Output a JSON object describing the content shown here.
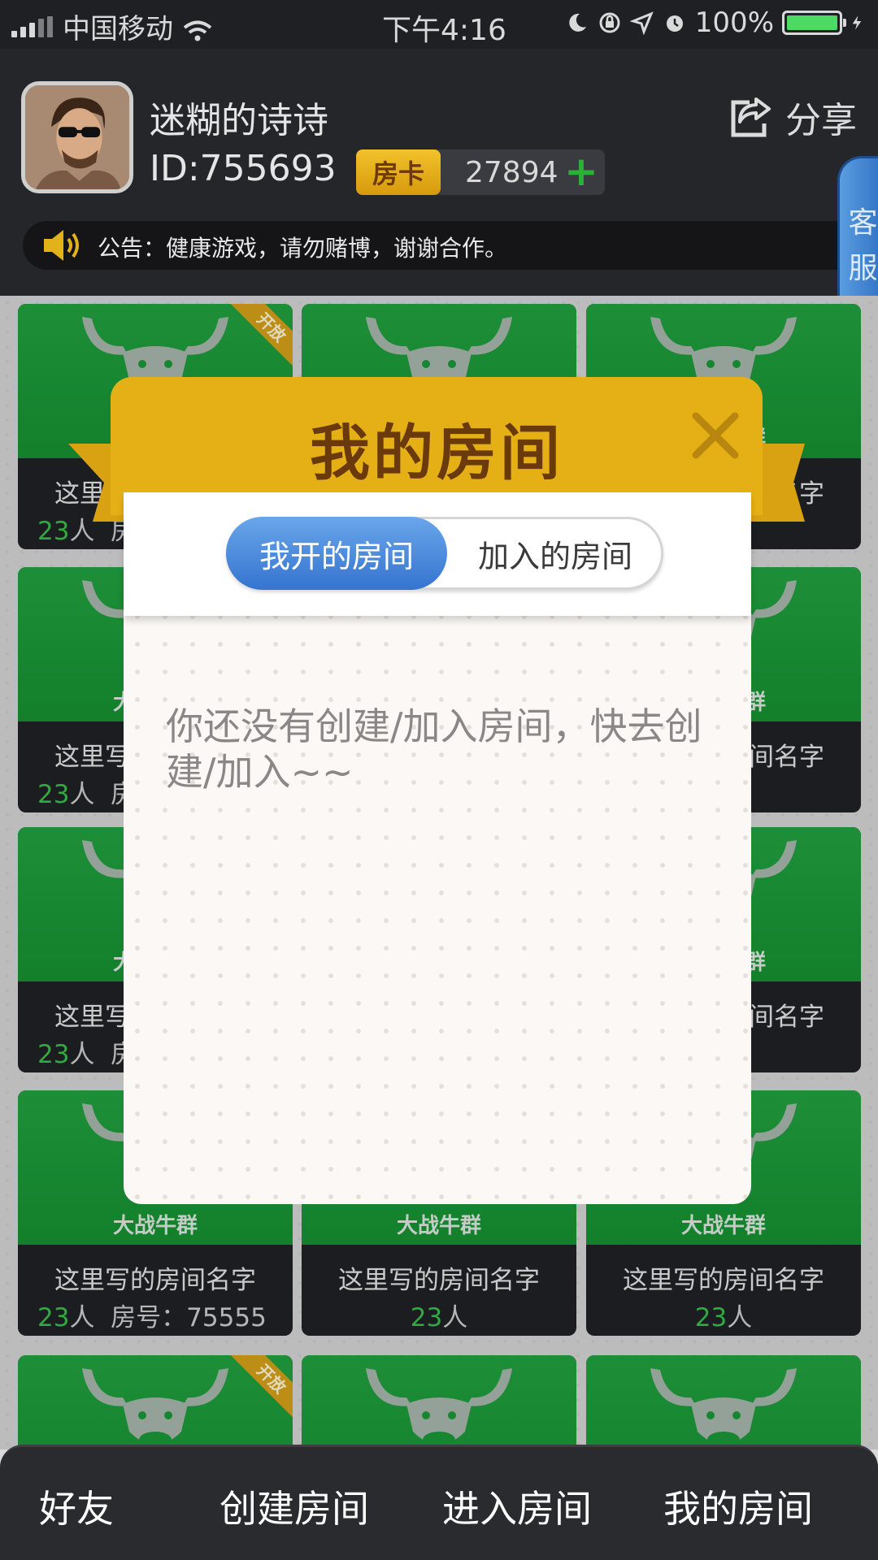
{
  "status_bar": {
    "carrier": "中国移动",
    "time": "下午4:16",
    "battery": "100%"
  },
  "user": {
    "name": "迷糊的诗诗",
    "id": "ID:755693",
    "card_label": "房卡",
    "card_count": "27894"
  },
  "share_label": "分享",
  "notice": "公告：健康游戏，请勿赌博，谢谢合作。",
  "kefu": [
    "客",
    "服"
  ],
  "rooms": {
    "game_name": "大战牛群",
    "room_name": "这里写的房间名字",
    "people": "23",
    "people_unit": "人",
    "room_no": "房号：75555",
    "ribbon": "开放"
  },
  "dialog": {
    "title": "我的房间",
    "tab_mine": "我开的房间",
    "tab_joined": "加入的房间",
    "empty": "你还没有创建/加入房间，快去创建/加入~~"
  },
  "nav": {
    "friends": "好友",
    "create": "创建房间",
    "enter": "进入房间",
    "mine": "我的房间"
  }
}
